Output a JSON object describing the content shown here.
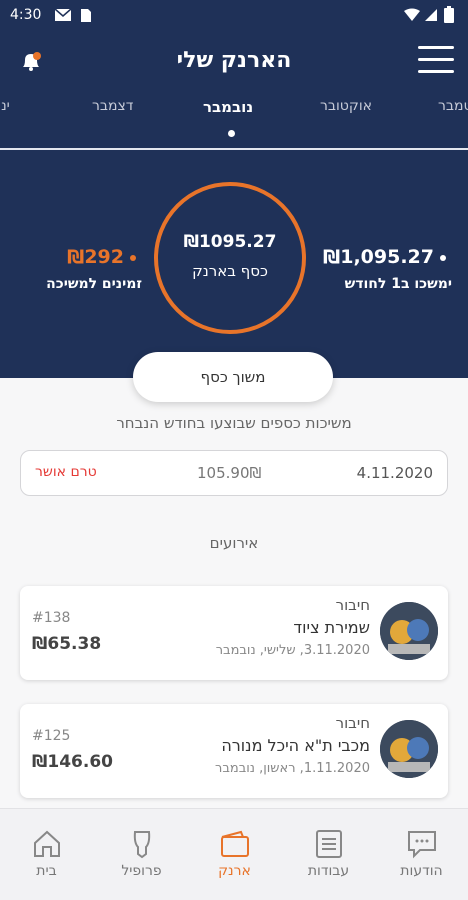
{
  "status_bar": {
    "time": "4:30"
  },
  "header": {
    "title": "הארנק שלי",
    "months": [
      "ינואר",
      "דצמבר",
      "נובמבר",
      "אוקטובר",
      "ספטמבר"
    ],
    "active_month": "נובמבר"
  },
  "summary": {
    "wallet_amount": "₪1095.27",
    "wallet_label": "כסף בארנק",
    "left_amount": "₪292",
    "left_label": "זמינים למשיכה",
    "right_amount": "₪1,095.27",
    "right_label": "ימשכו ב1 לחודש"
  },
  "withdraw_button": "משוך כסף",
  "withdrawals": {
    "title": "משיכות כספים שבוצעו בחודש הנבחר",
    "rows": [
      {
        "date": "4.11.2020",
        "amount": "105.90₪",
        "status": "טרם אושר"
      }
    ]
  },
  "events": {
    "title": "אירועים",
    "items": [
      {
        "type": "חיבור",
        "name": "שמירת ציוד",
        "date": "3.11.2020, שלישי, נובמבר",
        "number": "#138",
        "amount": "₪65.38"
      },
      {
        "type": "חיבור",
        "name": "מכבי ת\"א היכל מנורה",
        "date": "1.11.2020, ראשון, נובמבר",
        "number": "#125",
        "amount": "₪146.60"
      }
    ]
  },
  "nav": {
    "items": [
      {
        "label": "הודעות",
        "icon": "chat-icon"
      },
      {
        "label": "עבודות",
        "icon": "list-icon"
      },
      {
        "label": "ארנק",
        "icon": "wallet-icon"
      },
      {
        "label": "פרופיל",
        "icon": "profile-icon"
      },
      {
        "label": "בית",
        "icon": "home-icon"
      }
    ],
    "active": "ארנק"
  },
  "colors": {
    "navy": "#1f3158",
    "accent": "#e8742a",
    "alert": "#e53935"
  }
}
